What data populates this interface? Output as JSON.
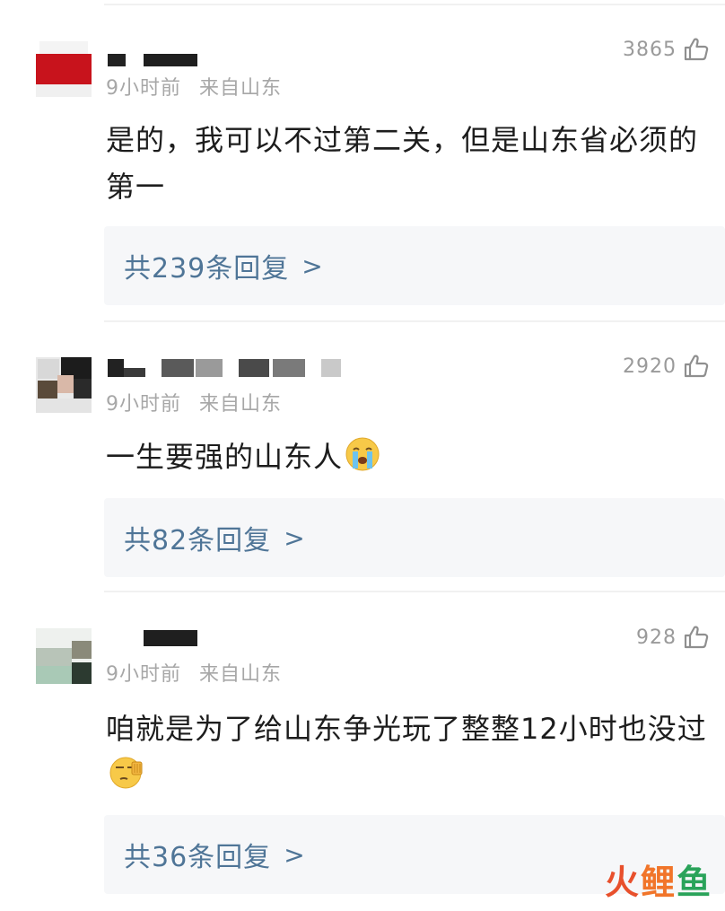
{
  "comments": [
    {
      "time": "9小时前",
      "location": "来自山东",
      "likes": "3865",
      "text": "是的，我可以不过第二关，但是山东省必须的第一",
      "reply_label": "共239条回复",
      "reply_arrow": ">"
    },
    {
      "time": "9小时前",
      "location": "来自山东",
      "likes": "2920",
      "text": "一生要强的山东人",
      "emoji": "crying-face",
      "reply_label": "共82条回复",
      "reply_arrow": ">"
    },
    {
      "time": "9小时前",
      "location": "来自山东",
      "likes": "928",
      "text": "咱就是为了给山东争光玩了整整12小时也没过",
      "emoji": "salute-face",
      "reply_label": "共36条回复",
      "reply_arrow": ">"
    }
  ],
  "watermark": {
    "part1": "火",
    "part2": "鲤",
    "part3": "鱼"
  }
}
